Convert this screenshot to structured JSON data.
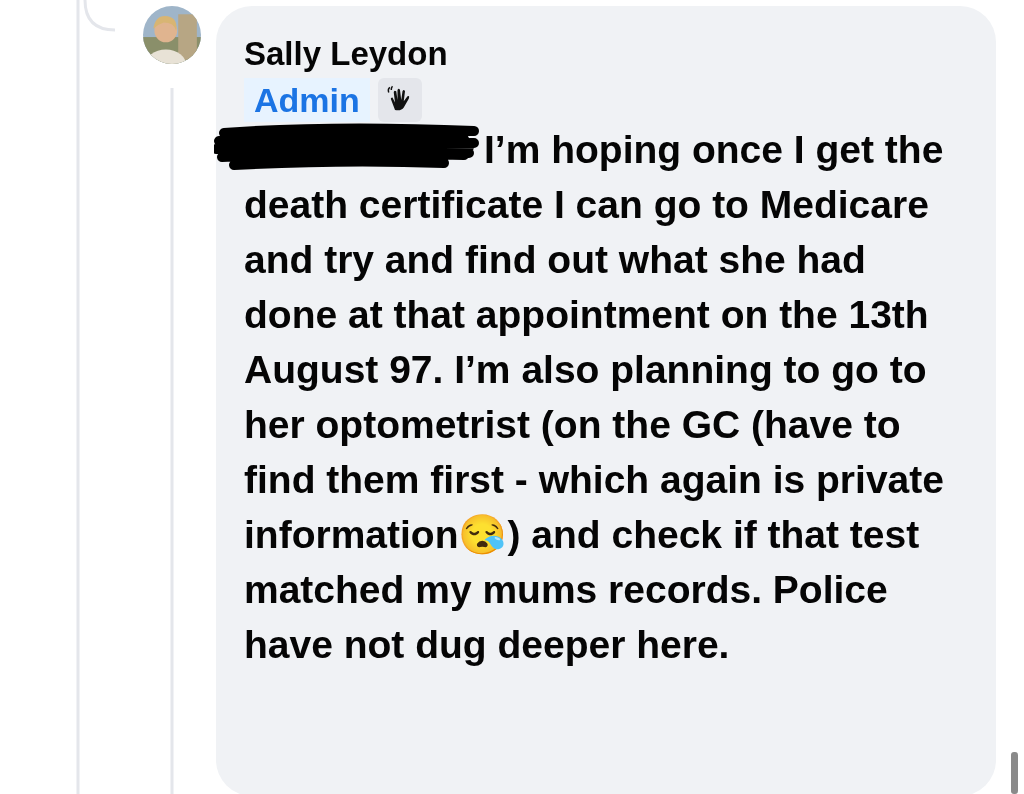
{
  "comment": {
    "author": "Sally Leydon",
    "badge": "Admin",
    "text": "I’m hoping once I get the death certificate I can go to Medicare and try and find out what she had done at that appointment on the 13th August 97. I’m also planning to go to her optometrist (on the GC (have to find them first - which again is private information😪) and check if that test matched my mums records. Police have not dug deeper here."
  }
}
